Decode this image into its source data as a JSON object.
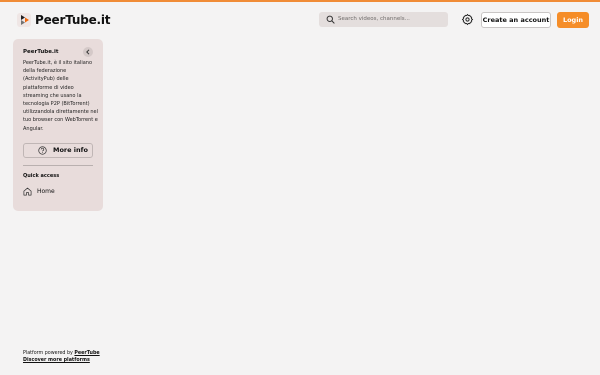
{
  "header": {
    "brand": "PeerTube.it",
    "search_placeholder": "Search videos, channels...",
    "create_account_label": "Create an account",
    "login_label": "Login"
  },
  "sidebar": {
    "title": "PeerTube.it",
    "description": "PeerTube.it, è il sito italiano della federazione (ActivityPub) delle piattaforme di video streaming che usano la tecnologia P2P (BitTorrent) utilizzandola direttamente nel tuo browser con WebTorrent e Angular.",
    "more_info_label": "More info",
    "quick_access_label": "Quick access",
    "home_label": "Home"
  },
  "footer": {
    "powered_prefix": "Platform powered by ",
    "powered_link": "PeerTube",
    "discover_label": "Discover more platforms"
  },
  "colors": {
    "accent": "#f58d28",
    "background": "#f4f3f3",
    "sidebar_bg": "#e8dcdb",
    "search_bg": "#e4dedd"
  }
}
